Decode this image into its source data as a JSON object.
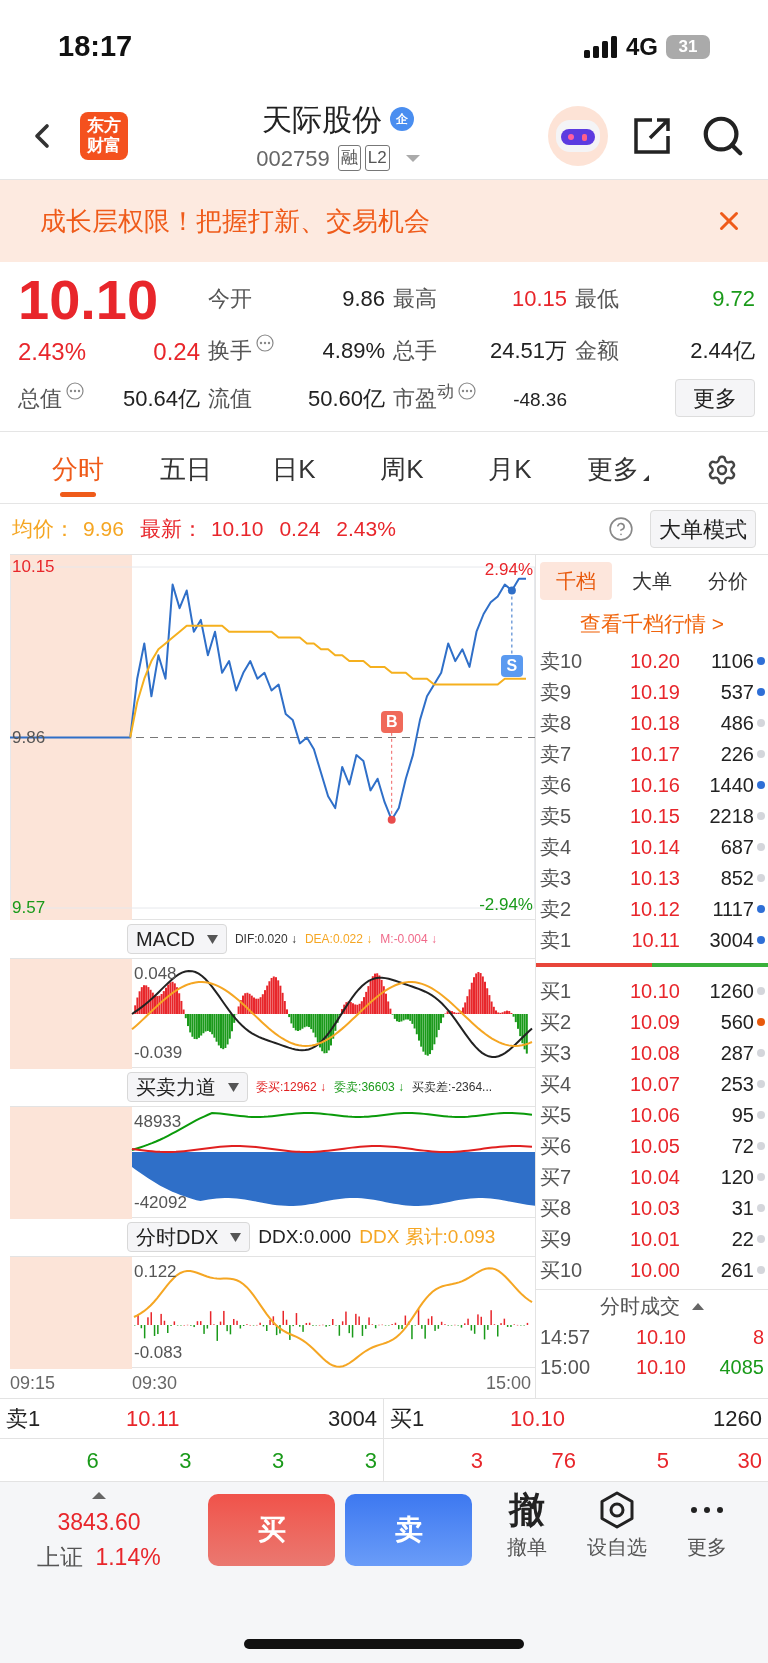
{
  "status_bar": {
    "time": "18:17",
    "network": "4G",
    "battery": "31"
  },
  "header": {
    "logo_lines": [
      "东方",
      "财富"
    ],
    "title": "天际股份",
    "badge": "企",
    "code": "002759",
    "tags": [
      "融",
      "L2"
    ]
  },
  "banner": {
    "text": "成长层权限！把握打新、交易机会"
  },
  "quote": {
    "price": "10.10",
    "change_pct": "2.43%",
    "change": "0.24",
    "more_button": "更多",
    "stats": [
      {
        "label": "今开",
        "value": "9.86",
        "color": "#222222",
        "info": false
      },
      {
        "label": "最高",
        "value": "10.15",
        "color": "#e8262b",
        "info": false
      },
      {
        "label": "最低",
        "value": "9.72",
        "color": "#1a9a1a",
        "info": false
      },
      {
        "label": "换手",
        "value": "4.89%",
        "color": "#222222",
        "info": true
      },
      {
        "label": "总手",
        "value": "24.51万",
        "color": "#222222",
        "info": false
      },
      {
        "label": "金额",
        "value": "2.44亿",
        "color": "#222222",
        "info": false
      },
      {
        "label": "总值",
        "value": "50.64亿",
        "color": "#222222",
        "info": true
      },
      {
        "label": "流值",
        "value": "50.60亿",
        "color": "#222222",
        "info": false
      },
      {
        "label": "市盈$^{动}$",
        "value": "-48.36",
        "color": "#222222",
        "info": true
      }
    ]
  },
  "chart_tabs": [
    {
      "label": "分时",
      "selected": true,
      "kind": "tab"
    },
    {
      "label": "五日",
      "selected": false,
      "kind": "tab"
    },
    {
      "label": "日K",
      "selected": false,
      "kind": "tab"
    },
    {
      "label": "周K",
      "selected": false,
      "kind": "tab"
    },
    {
      "label": "月K",
      "selected": false,
      "kind": "tab"
    },
    {
      "label": "更多",
      "selected": false,
      "kind": "menu"
    }
  ],
  "info_line": {
    "avg_label": "均价：",
    "avg": "9.96",
    "last_label": "最新：",
    "last": "10.10",
    "change": "0.24",
    "pct": "2.43%",
    "mode_button": "大单模式"
  },
  "price_chart": {
    "pct_max": "2.94%",
    "pct_min": "-2.94%",
    "buy_marker": "B",
    "sell_marker": "S",
    "chart_data": {
      "type": "line",
      "categories": [
        null,
        null,
        null,
        null,
        null,
        null,
        null,
        null,
        null,
        null,
        null,
        null,
        null,
        null,
        null,
        null,
        null,
        null,
        null,
        null,
        null,
        null,
        null,
        null,
        null,
        null,
        null,
        null,
        null,
        null,
        null,
        null,
        null,
        null,
        null,
        null,
        null,
        null,
        null,
        null,
        null,
        null,
        null,
        null,
        null,
        null,
        null,
        null,
        null,
        null,
        null,
        null,
        null,
        null,
        null,
        null,
        null,
        null,
        null,
        null,
        null,
        null,
        null,
        null,
        null,
        null,
        null,
        null,
        null,
        null,
        null,
        null,
        null,
        null
      ],
      "ylim": [
        9.57,
        10.15
      ],
      "yticks": [
        {
          "value": 10.15,
          "label": "10.15"
        },
        {
          "value": 9.86,
          "label": "9.86"
        },
        {
          "value": 9.57,
          "label": "9.57"
        }
      ],
      "series": [
        {
          "color": "#2f6fc8",
          "values": [
            9.86,
            9.86,
            9.86,
            9.86,
            9.86,
            9.86,
            9.86,
            9.86,
            9.86,
            9.86,
            9.86,
            9.86,
            9.86,
            9.86,
            9.86,
            9.86,
            9.86,
            9.86,
            9.96,
            10.02,
            9.93,
            10.0,
            9.96,
            10.12,
            10.08,
            10.11,
            10.04,
            10.06,
            10.0,
            10.04,
            9.97,
            9.99,
            9.94,
            9.97,
            9.99,
            9.96,
            9.97,
            9.94,
            9.95,
            9.9,
            9.89,
            9.85,
            9.86,
            9.84,
            9.8,
            9.76,
            9.74,
            9.81,
            9.78,
            9.83,
            9.82,
            9.77,
            9.79,
            9.75,
            9.72,
            9.74,
            9.79,
            9.83,
            9.89,
            9.93,
            9.95,
            9.97,
            10.02,
            9.99,
            10.01,
            9.98,
            10.04,
            10.07,
            10.09,
            10.1,
            10.12,
            10.11,
            10.13,
            10.13
          ]
        },
        {
          "color": "#f5b01e",
          "values": [
            null,
            null,
            null,
            null,
            null,
            null,
            null,
            null,
            null,
            null,
            null,
            null,
            null,
            null,
            null,
            null,
            null,
            9.86,
            9.92,
            9.96,
            9.99,
            10.01,
            10.02,
            10.03,
            10.04,
            10.05,
            10.05,
            10.05,
            10.05,
            10.05,
            10.05,
            10.04,
            10.04,
            10.04,
            10.04,
            10.04,
            10.04,
            10.04,
            10.03,
            10.03,
            10.03,
            10.03,
            10.02,
            10.02,
            10.01,
            10.01,
            10.0,
            10.0,
            9.99,
            9.99,
            9.99,
            9.98,
            9.98,
            9.98,
            9.97,
            9.97,
            9.97,
            9.96,
            9.96,
            9.96,
            9.95,
            9.95,
            9.95,
            9.95,
            9.95,
            9.95,
            9.95,
            9.95,
            9.95,
            9.95,
            9.96,
            9.96,
            9.96,
            9.96
          ]
        }
      ]
    }
  },
  "indicators": [
    {
      "kind": "macd",
      "selector": "MACD",
      "y_max": "0.048",
      "y_min": "-0.039",
      "stats": [
        {
          "text": "DIF:0.020 ↓",
          "color": "#333333"
        },
        {
          "text": "DEA:0.022 ↓",
          "color": "#f5a623"
        },
        {
          "text": "M:-0.004 ↓",
          "color": "#f06a8a"
        }
      ]
    },
    {
      "kind": "force",
      "selector": "买卖力道",
      "y_max": "48933",
      "y_min": "-42092",
      "stats": [
        {
          "text": "委买:12962 ↓",
          "color": "#e02020"
        },
        {
          "text": "委卖:36603 ↓",
          "color": "#1a9a1a"
        },
        {
          "text": "买卖差:-2364...",
          "color": "#333333"
        }
      ]
    },
    {
      "kind": "ddx",
      "selector": "分时DDX",
      "y_max": "0.122",
      "y_min": "-0.083",
      "stats": [
        {
          "text": "DDX:0.000",
          "color": "#222222"
        },
        {
          "text": "DDX 累计:0.093",
          "color": "#f5a623"
        }
      ]
    }
  ],
  "time_axis": [
    "09:15",
    "09:30",
    "15:00"
  ],
  "order_book": {
    "tabs": [
      {
        "label": "千档",
        "selected": true
      },
      {
        "label": "大单",
        "selected": false
      },
      {
        "label": "分价",
        "selected": false
      }
    ],
    "link": "查看千档行情 >",
    "asks": [
      {
        "label": "卖10",
        "price": "10.20",
        "volume": "1106",
        "color": "#2f6fd6"
      },
      {
        "label": "卖9",
        "price": "10.19",
        "volume": "537",
        "color": "#2f6fd6"
      },
      {
        "label": "卖8",
        "price": "10.18",
        "volume": "486",
        "color": "#d4d6db"
      },
      {
        "label": "卖7",
        "price": "10.17",
        "volume": "226",
        "color": "#d4d6db"
      },
      {
        "label": "卖6",
        "price": "10.16",
        "volume": "1440",
        "color": "#2f6fd6"
      },
      {
        "label": "卖5",
        "price": "10.15",
        "volume": "2218",
        "color": "#d4d6db"
      },
      {
        "label": "卖4",
        "price": "10.14",
        "volume": "687",
        "color": "#d4d6db"
      },
      {
        "label": "卖3",
        "price": "10.13",
        "volume": "852",
        "color": "#d4d6db"
      },
      {
        "label": "卖2",
        "price": "10.12",
        "volume": "1117",
        "color": "#2f6fd6"
      },
      {
        "label": "卖1",
        "price": "10.11",
        "volume": "3004",
        "color": "#2f6fd6"
      }
    ],
    "bids": [
      {
        "label": "买1",
        "price": "10.10",
        "volume": "1260",
        "color": "#d4d6db"
      },
      {
        "label": "买2",
        "price": "10.09",
        "volume": "560",
        "color": "#e8590c"
      },
      {
        "label": "买3",
        "price": "10.08",
        "volume": "287",
        "color": "#d4d6db"
      },
      {
        "label": "买4",
        "price": "10.07",
        "volume": "253",
        "color": "#d4d6db"
      },
      {
        "label": "买5",
        "price": "10.06",
        "volume": "95",
        "color": "#d4d6db"
      },
      {
        "label": "买6",
        "price": "10.05",
        "volume": "72",
        "color": "#d4d6db"
      },
      {
        "label": "买7",
        "price": "10.04",
        "volume": "120",
        "color": "#d4d6db"
      },
      {
        "label": "买8",
        "price": "10.03",
        "volume": "31",
        "color": "#d4d6db"
      },
      {
        "label": "买9",
        "price": "10.01",
        "volume": "22",
        "color": "#d4d6db"
      },
      {
        "label": "买10",
        "price": "10.00",
        "volume": "261",
        "color": "#d4d6db"
      }
    ],
    "trades_title": "分时成交",
    "trades": [
      {
        "time": "14:57",
        "price": "10.10",
        "volume": "8",
        "color": "#e8262b"
      },
      {
        "time": "15:00",
        "price": "10.10",
        "volume": "4085",
        "color": "#1a9a1a"
      }
    ]
  },
  "summary": {
    "ask": {
      "label": "卖1",
      "price": "10.11",
      "volume": "3004",
      "counts": [
        "6",
        "3",
        "3",
        "3"
      ]
    },
    "bid": {
      "label": "买1",
      "price": "10.10",
      "volume": "1260",
      "counts": [
        "3",
        "76",
        "5",
        "30"
      ]
    }
  },
  "bottom_bar": {
    "index_value": "3843.60",
    "index_name": "上证",
    "index_pct": "1.14%",
    "buy": "买",
    "sell": "卖",
    "actions": [
      {
        "kind": "glyph",
        "glyph": "撤",
        "label": "撤单"
      },
      {
        "kind": "hexagon",
        "label": "设自选"
      },
      {
        "kind": "dots",
        "label": "更多"
      }
    ]
  }
}
